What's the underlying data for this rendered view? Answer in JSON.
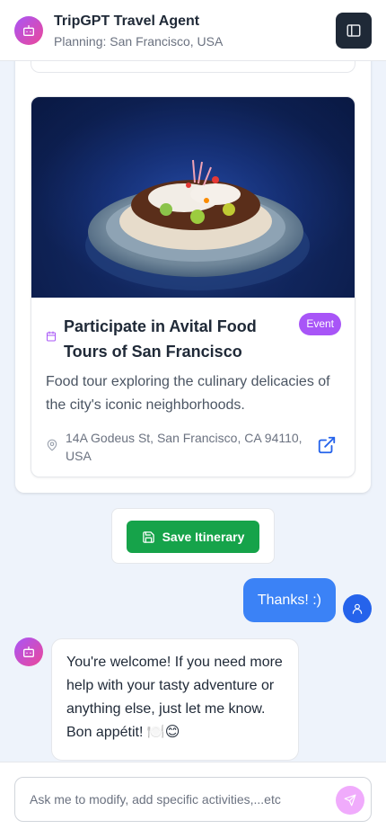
{
  "header": {
    "title": "TripGPT Travel Agent",
    "subtitle": "Planning: San Francisco, USA",
    "avatar_icon": "bot-icon",
    "menu_icon": "menu-icon"
  },
  "event": {
    "title": "Participate in Avital Food Tours of San Francisco",
    "badge": "Event",
    "description": "Food tour exploring the culinary delicacies of the city's iconic neighborhoods.",
    "address": "14A Godeus St, San Francisco, CA 94110, USA",
    "image_alt": "plated tostada with toppings on blue background",
    "badge_color": "#a855f7"
  },
  "save_button": {
    "label": "Save Itinerary",
    "color": "#16a34a"
  },
  "messages": [
    {
      "role": "user",
      "text": "Thanks! :)"
    },
    {
      "role": "assistant",
      "text": "You're welcome! If you need more help with your tasty adventure or anything else, just let me know. Bon appétit! 🍽️😊"
    }
  ],
  "composer": {
    "placeholder": "Ask me to modify, add specific activities,...etc",
    "value": ""
  },
  "colors": {
    "accent": "#3b82f6",
    "brand_gradient_start": "#a855f7",
    "brand_gradient_end": "#ec4899"
  }
}
